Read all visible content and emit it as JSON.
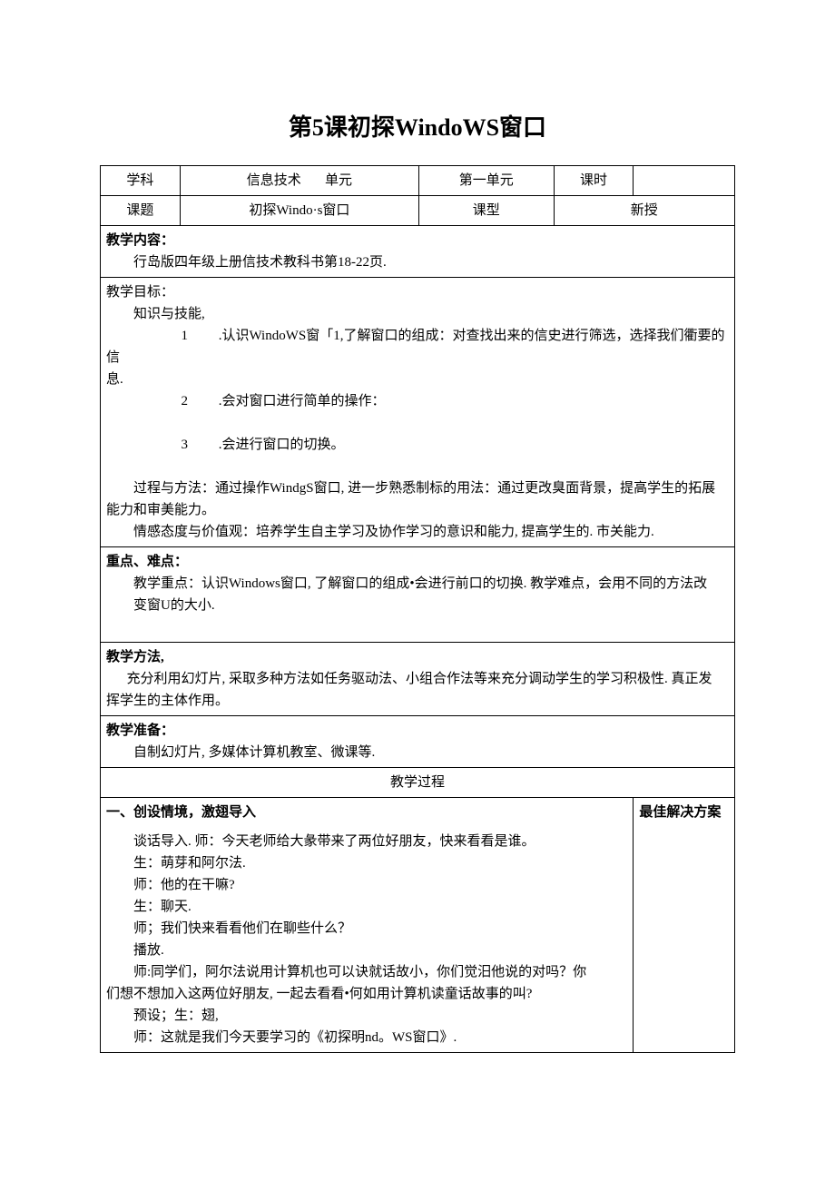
{
  "title": "第5课初探WindoWS窗口",
  "header": {
    "labels": {
      "subject": "学科",
      "unit": "单元",
      "period": "课时",
      "topic": "课题",
      "type": "课型"
    },
    "values": {
      "subject": "信息技术",
      "unit": "第一单元",
      "period": "",
      "topic": "初探Windo·s窗口",
      "type": "新授"
    }
  },
  "sections": {
    "content": {
      "label": "教学内容：",
      "body": "行岛版四年级上册信技术教科书第18-22页."
    },
    "goals": {
      "label": "教学目标：",
      "line_knowledge": "知识与技能,",
      "item1_num": "1",
      "item1_text": ".认识WindoWS窗「1,了解窗口的组成：对查找出来的信史进行筛选，选择我们衢要的信",
      "item1_cont": "息.",
      "item2_num": "2",
      "item2_text": ".会对窗口进行简单的操作：",
      "item3_num": "3",
      "item3_text": ".会进行窗口的切换。",
      "process": "过程与方法：通过操作WindgS窗口, 进一步熟悉制标的用法：通过更改臭面背景，提高学生的拓展",
      "process_cont": "能力和审美能力。",
      "emotion": "情感态度与价值观：培养学生自主学习及协作学习的意识和能力, 提高学生的. 市关能力."
    },
    "keypoints": {
      "label": "重点、难点：",
      "line1": "教学重点：认识Windows窗口, 了解窗口的组成•会进行前口的切换. 教学难点，会用不同的方法改",
      "line2": "变窗U的大小."
    },
    "methods": {
      "label": "教学方法,",
      "line1": "充分利用幻灯片, 采取多种方法如任务驱动法、小组合作法等来充分调动学生的学习积极性. 真正发",
      "line2": "挥学生的主体作用。"
    },
    "prep": {
      "label": "教学准备：",
      "body": "自制幻灯片, 多媒体计算机教室、微课等."
    },
    "process_header": "教学过程",
    "scene": {
      "label": "一、创设情境，激翅导入",
      "solution_label": "最佳解决方案",
      "lines": [
        "谈话导入. 师：今天老师给大彖带来了两位好朋友，快来看看是谁。",
        "生：萌芽和阿尔法.",
        "师：他的在干嘛?",
        "生：聊天.",
        "师；我们快来看看他们在聊些什么？",
        "播放.",
        "师:同学们，阿尔法说用计算机也可以诀就话故小，你们觉汨他说的对吗？你",
        "们想不想加入这两位好朋友, 一起去看看•何如用计算机读童话故事的叫?",
        "预设；生：翅,",
        "师：这就是我们今天要学习的《初探明nd。WS窗口》."
      ]
    }
  }
}
